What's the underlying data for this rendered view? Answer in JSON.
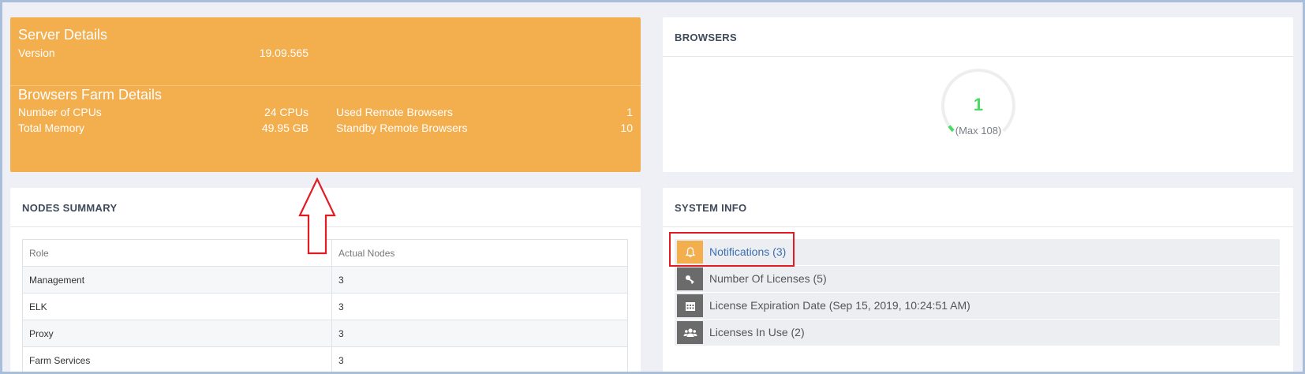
{
  "server_details": {
    "title": "Server Details",
    "version_label": "Version",
    "version_value": "19.09.565"
  },
  "farm_details": {
    "title": "Browsers Farm Details",
    "cpus_label": "Number of CPUs",
    "cpus_value": "24 CPUs",
    "memory_label": "Total Memory",
    "memory_value": "49.95 GB",
    "used_label": "Used Remote Browsers",
    "used_value": "1",
    "standby_label": "Standby Remote Browsers",
    "standby_value": "10"
  },
  "browsers": {
    "title": "BROWSERS",
    "gauge_value": "1",
    "gauge_max_text": "(Max 108)",
    "gauge_max": 108,
    "gauge_color": "#4cd964"
  },
  "nodes_summary": {
    "title": "NODES SUMMARY",
    "columns": [
      "Role",
      "Actual Nodes"
    ],
    "rows": [
      [
        "Management",
        "3"
      ],
      [
        "ELK",
        "3"
      ],
      [
        "Proxy",
        "3"
      ],
      [
        "Farm Services",
        "3"
      ]
    ]
  },
  "system_info": {
    "title": "SYSTEM INFO",
    "items": [
      {
        "label": "Notifications",
        "count": "(3)",
        "icon": "bell-icon"
      },
      {
        "label": "Number Of Licenses (5)",
        "icon": "key-icon"
      },
      {
        "label": "License Expiration Date (Sep 15, 2019, 10:24:51 AM)",
        "icon": "calendar-icon"
      },
      {
        "label": "Licenses In Use (2)",
        "icon": "users-icon"
      }
    ]
  },
  "colors": {
    "server_card": "#f3ae4e",
    "annotation_red": "#e31b23",
    "frame_border": "#a9bedb"
  }
}
